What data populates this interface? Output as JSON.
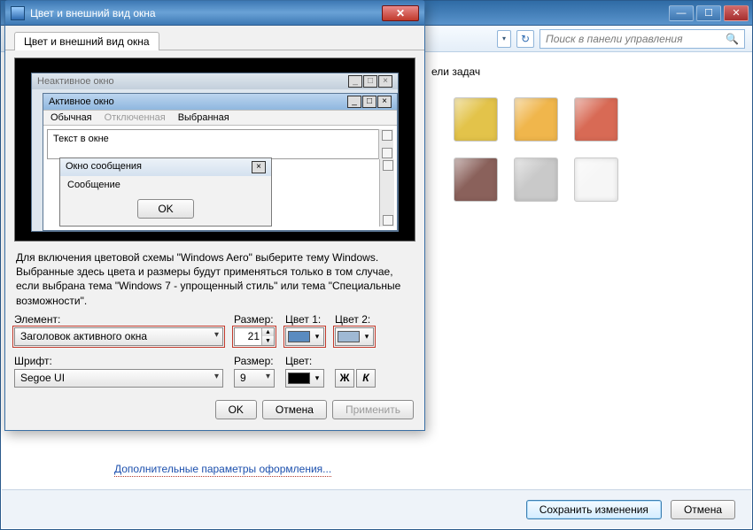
{
  "parent": {
    "search_placeholder": "Поиск в панели управления",
    "task_title_fragment": "ели задач",
    "swatch_colors_row1": [
      "#e3c34a",
      "#f0b64c",
      "#d86a55"
    ],
    "swatch_colors_row2": [
      "#8a615b",
      "#c9c9c9",
      "#f6f6f6"
    ],
    "hyperlink": "Дополнительные параметры оформления...",
    "save_btn": "Сохранить изменения",
    "cancel_btn": "Отмена"
  },
  "dlg": {
    "title": "Цвет и внешний вид окна",
    "tab": "Цвет и внешний вид окна",
    "preview": {
      "inactive": "Неактивное окно",
      "active": "Активное окно",
      "menu_normal": "Обычная",
      "menu_disabled": "Отключенная",
      "menu_selected": "Выбранная",
      "textarea": "Текст в окне",
      "msg_title": "Окно сообщения",
      "msg_body": "Сообщение",
      "msg_ok": "OK"
    },
    "desc": "Для включения цветовой схемы \"Windows Aero\" выберите тему Windows. Выбранные здесь цвета и размеры будут применяться только в том случае, если выбрана тема \"Windows 7 - упрощенный стиль\" или тема \"Специальные возможности\".",
    "labels": {
      "element": "Элемент:",
      "size": "Размер:",
      "color1": "Цвет 1:",
      "color2": "Цвет 2:",
      "font": "Шрифт:",
      "color": "Цвет:"
    },
    "values": {
      "element": "Заголовок активного окна",
      "size1": "21",
      "color1": "#5a8bc0",
      "color2": "#9fb9d4",
      "font": "Segoe UI",
      "size2": "9",
      "fontcolor": "#000000",
      "bold": "Ж",
      "italic": "К"
    },
    "buttons": {
      "ok": "OK",
      "cancel": "Отмена",
      "apply": "Применить"
    }
  }
}
